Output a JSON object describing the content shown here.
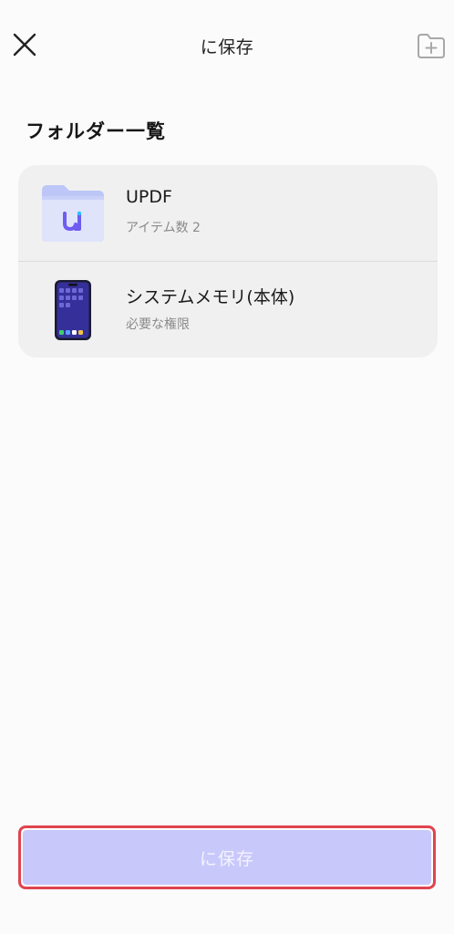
{
  "header": {
    "title": "に保存",
    "close_icon": "close-icon",
    "new_folder_icon": "new-folder-icon"
  },
  "section": {
    "title": "フォルダー一覧"
  },
  "folders": [
    {
      "name": "UPDF",
      "subtitle": "アイテム数 2",
      "icon": "updf-folder-icon"
    },
    {
      "name": "システムメモリ(本体)",
      "subtitle": "必要な権限",
      "icon": "phone-icon"
    }
  ],
  "save_button": {
    "label": "に保存"
  },
  "colors": {
    "background": "#fbfbfb",
    "card": "#f0f0f0",
    "save_button_bg": "#c9c8fb",
    "highlight_border": "#e0444f",
    "folder_accent": "#a9b4f5"
  }
}
